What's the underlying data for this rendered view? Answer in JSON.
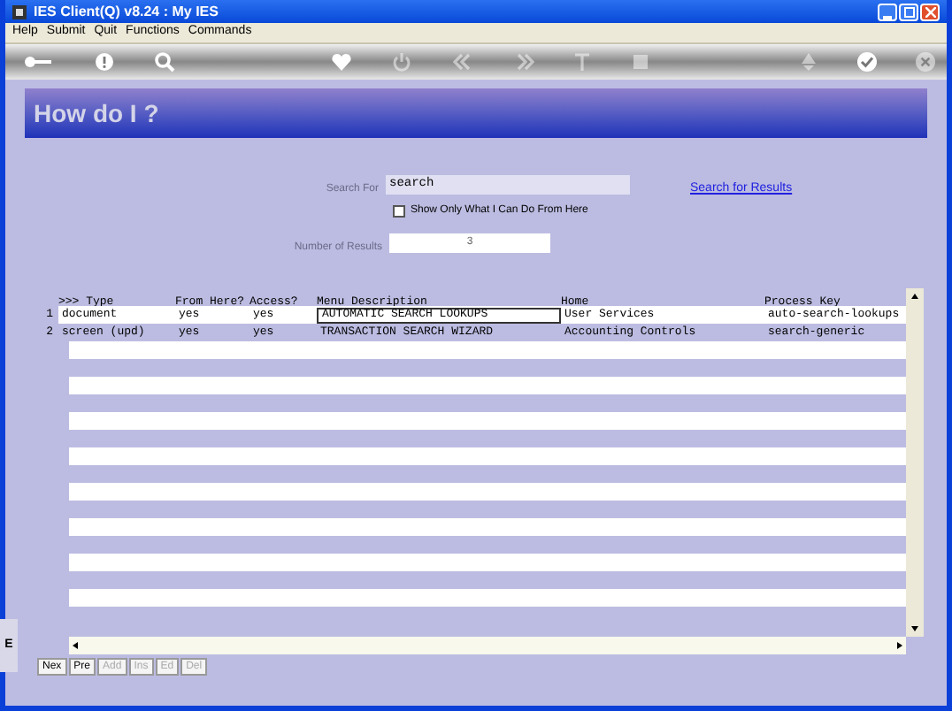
{
  "window": {
    "title": "IES Client(Q) v8.24 : My IES"
  },
  "menu": [
    "Help",
    "Submit",
    "Quit",
    "Functions",
    "Commands"
  ],
  "toolbar": [
    {
      "kind": "key",
      "disabled": false
    },
    {
      "kind": "help",
      "disabled": false
    },
    {
      "kind": "search",
      "disabled": false
    },
    {
      "kind": "heart",
      "disabled": false
    },
    {
      "kind": "power",
      "disabled": true
    },
    {
      "kind": "back",
      "disabled": true
    },
    {
      "kind": "forward",
      "disabled": true
    },
    {
      "kind": "text",
      "disabled": true
    },
    {
      "kind": "stop",
      "disabled": true
    },
    {
      "kind": "recycle",
      "disabled": true
    },
    {
      "kind": "check",
      "disabled": false
    },
    {
      "kind": "close",
      "disabled": true
    }
  ],
  "header": {
    "title": "How do I ?"
  },
  "search": {
    "label": "Search For",
    "value": "search",
    "link": "Search for Results"
  },
  "filter": {
    "label": "Show Only What I Can Do From Here",
    "checked": false
  },
  "results": {
    "label": "Number of Results",
    "value": "3"
  },
  "table": {
    "columns": [
      ">>> Type",
      "From Here?",
      "Access?",
      "Menu Description",
      "Home",
      "Process Key"
    ],
    "rows": [
      {
        "number": "1",
        "cells": [
          "document",
          "yes",
          "yes",
          "AUTOMATIC SEARCH LOOKUPS",
          "User Services",
          "auto-search-lookups"
        ],
        "focused": true
      },
      {
        "number": "2",
        "cells": [
          "screen (upd)",
          "yes",
          "yes",
          "TRANSACTION SEARCH WIZARD",
          "Accounting Controls",
          "search-generic"
        ],
        "focused": false
      }
    ]
  },
  "side_tab": {
    "label": "E"
  },
  "buttons": [
    {
      "label": "Nex",
      "disabled": false
    },
    {
      "label": "Pre",
      "disabled": false
    },
    {
      "label": "Add",
      "disabled": true
    },
    {
      "label": "Ins",
      "disabled": true
    },
    {
      "label": "Ed",
      "disabled": true
    },
    {
      "label": "Del",
      "disabled": true
    }
  ]
}
